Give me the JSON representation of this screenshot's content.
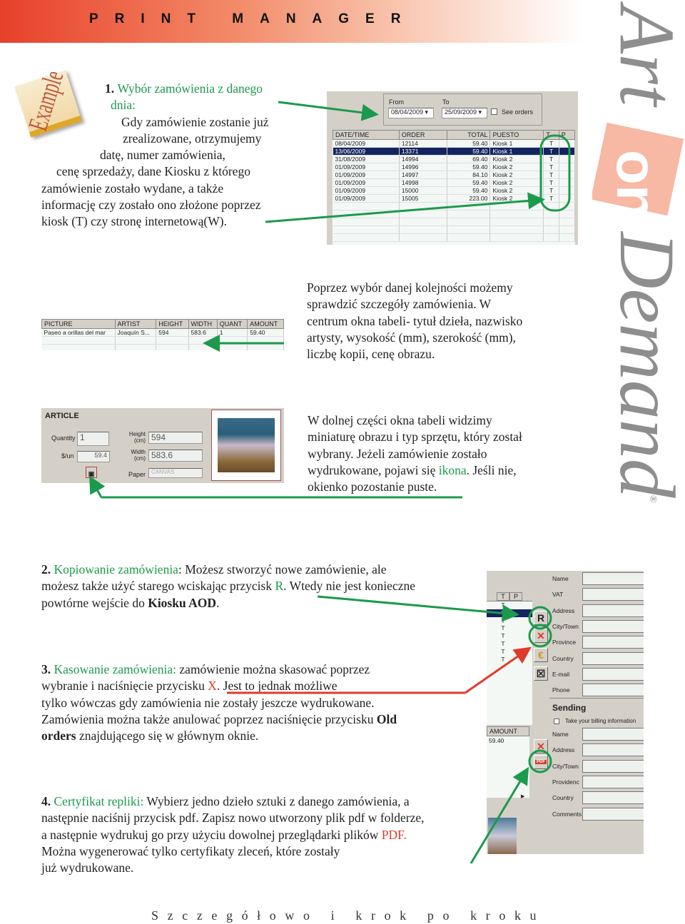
{
  "header": {
    "title": "PRINT MANAGER"
  },
  "logo": {
    "text": "Art on Demand",
    "registered": "®"
  },
  "badge": {
    "text": "Example"
  },
  "colors": {
    "green": "#1b9a4c",
    "red": "#e23a2a",
    "header_start": "#e8402a",
    "selected_row": "#14245e"
  },
  "section1": [
    [
      {
        "t": "1. ",
        "s": "b"
      },
      {
        "t": "Wybór zamówienia z danego",
        "s": "g"
      }
    ],
    [
      {
        "t": "dnia:",
        "s": "g"
      }
    ],
    [
      {
        "t": "Gdy zamówienie zostanie już"
      }
    ],
    [
      {
        "t": "zrealizowane, otrzymujemy"
      }
    ],
    [
      {
        "t": "datę, numer zamówienia,"
      }
    ],
    [
      {
        "t": "cenę sprzedaży, dane Kiosku z którego"
      }
    ],
    [
      {
        "t": "zamówienie zostało wydane, a także"
      }
    ],
    [
      {
        "t": "informację czy zostało ono złożone poprzez"
      }
    ],
    [
      {
        "t": "kiosk (T) czy stronę internetową(W)."
      }
    ]
  ],
  "para2": [
    [
      {
        "t": "Poprzez wybór danej kolejności możemy"
      }
    ],
    [
      {
        "t": "sprawdzić szczegóły zamówienia. W"
      }
    ],
    [
      {
        "t": "centrum okna tabeli- tytuł dzieła, nazwisko"
      }
    ],
    [
      {
        "t": "artysty, wysokość (mm), szerokość (mm),"
      }
    ],
    [
      {
        "t": "liczbę kopii, cenę obrazu."
      }
    ]
  ],
  "para3": [
    [
      {
        "t": "W dolnej części okna tabeli widzimy"
      }
    ],
    [
      {
        "t": "miniaturę obrazu i typ sprzętu, który został"
      }
    ],
    [
      {
        "t": "wybrany. Jeżeli zamówienie zostało"
      }
    ],
    [
      {
        "t": "wydrukowane, pojawi się "
      },
      {
        "t": "ikona",
        "s": "g"
      },
      {
        "t": ". Jeśli nie,"
      }
    ],
    [
      {
        "t": "okienko  pozostanie puste."
      }
    ]
  ],
  "section2": [
    [
      {
        "t": "2. ",
        "s": "b"
      },
      {
        "t": "Kopiowanie zamówienia",
        "s": "g"
      },
      {
        "t": ": Możesz stworzyć nowe zamówienie, ale"
      }
    ],
    [
      {
        "t": "możesz także  użyć starego wciskając przycisk "
      },
      {
        "t": "R",
        "s": "g"
      },
      {
        "t": ". Wtedy nie jest konieczne"
      }
    ],
    [
      {
        "t": "powtórne wejście do "
      },
      {
        "t": "Kiosku AOD",
        "s": "b"
      },
      {
        "t": "."
      }
    ]
  ],
  "section3": [
    [
      {
        "t": "3. ",
        "s": "b"
      },
      {
        "t": "Kasowanie zamówienia:",
        "s": "g"
      },
      {
        "t": " zamówienie można skasować poprzez"
      }
    ],
    [
      {
        "t": "wybranie i naciśnięcie przycisku "
      },
      {
        "t": "X",
        "s": "r"
      },
      {
        "t": ". Jest to jednak możliwe"
      }
    ],
    [
      {
        "t": " tylko wówczas gdy zamówienia nie zostały jeszcze wydrukowane."
      }
    ],
    [
      {
        "t": "Zamówienia można także anulować poprzez naciśnięcie przycisku "
      },
      {
        "t": "Old",
        "s": "b"
      }
    ],
    [
      {
        "t": "orders",
        "s": "b"
      },
      {
        "t": " znajdującego się w głównym oknie."
      }
    ]
  ],
  "section4": [
    [
      {
        "t": "4. ",
        "s": "b"
      },
      {
        "t": "Certyfikat repliki:",
        "s": "g"
      },
      {
        "t": " Wybierz jedno dzieło sztuki z danego zamówienia, a"
      }
    ],
    [
      {
        "t": "następnie naciśnij przycisk pdf. Zapisz nowo utworzony plik pdf w folderze,"
      }
    ],
    [
      {
        "t": "a następnie wydrukuj go przy użyciu dowolnej przeglądarki plików "
      },
      {
        "t": "PDF.",
        "s": "r"
      }
    ],
    [
      {
        "t": "Można wygenerować tylko certyfikaty zleceń, które zostały"
      }
    ],
    [
      {
        "t": "już wydrukowane."
      }
    ]
  ],
  "orders": {
    "from_label": "From",
    "from_value": "08/04/2009",
    "to_label": "To",
    "to_value": "25/09/2009",
    "see_orders": "See orders",
    "columns": [
      "DATE/TIME",
      "ORDER",
      "TOTAL",
      "PUESTO",
      "T",
      "P"
    ],
    "rows": [
      [
        "08/04/2009",
        "12114",
        "59.40",
        "Kiosk 1",
        "T",
        ""
      ],
      [
        "13/06/2009",
        "13371",
        "59.40",
        "Kiosk 1",
        "T",
        ""
      ],
      [
        "31/08/2009",
        "14994",
        "69.40",
        "Kiosk 2",
        "T",
        ""
      ],
      [
        "01/09/2009",
        "14996",
        "59.40",
        "Kiosk 2",
        "T",
        ""
      ],
      [
        "01/09/2009",
        "14997",
        "84.10",
        "Kiosk 2",
        "T",
        ""
      ],
      [
        "01/09/2009",
        "14998",
        "59.40",
        "Kiosk 2",
        "T",
        ""
      ],
      [
        "01/09/2009",
        "15000",
        "59.40",
        "Kiosk 2",
        "T",
        ""
      ],
      [
        "01/09/2009",
        "15005",
        "223.00",
        "Kiosk 2",
        "T",
        ""
      ]
    ],
    "selected_row": 1
  },
  "details": {
    "columns": [
      "PICTURE",
      "ARTIST",
      "HEIGHT",
      "WIDTH",
      "QUANT",
      "AMOUNT"
    ],
    "rows": [
      [
        "Paseo a orillas del mar",
        "Joaquín S...",
        "594",
        "583.6",
        "1",
        "59.40"
      ]
    ]
  },
  "article": {
    "title": "ARTICLE",
    "quantity_label": "Quantity",
    "quantity": "1",
    "price_label": "$/un",
    "price": "59.4",
    "height_label": "Height (cm)",
    "height": "594",
    "width_label": "Width (cm)",
    "width": "583.6",
    "paper_label": "Paper",
    "paper": "CANVAS"
  },
  "client": {
    "t_col": "T",
    "p_col": "P",
    "t_rows": [
      "T",
      "T",
      "T",
      "T",
      "T",
      "T",
      "T",
      "T"
    ],
    "fields": [
      "Name",
      "VAT",
      "Address",
      "City/Town",
      "Province",
      "Country",
      "E-mail",
      "Phone"
    ],
    "sending_title": "Sending",
    "billing_checkbox": "Take your billing information",
    "sending_fields": [
      "Name",
      "Address",
      "City/Town",
      "Providenc",
      "Country",
      "Comments"
    ],
    "amount_col": "AMOUNT",
    "amount": "59.40",
    "btn_r": "R",
    "btn_pdf": "PDF"
  },
  "footer": {
    "text": "Szczegółowo i krok po kroku"
  }
}
